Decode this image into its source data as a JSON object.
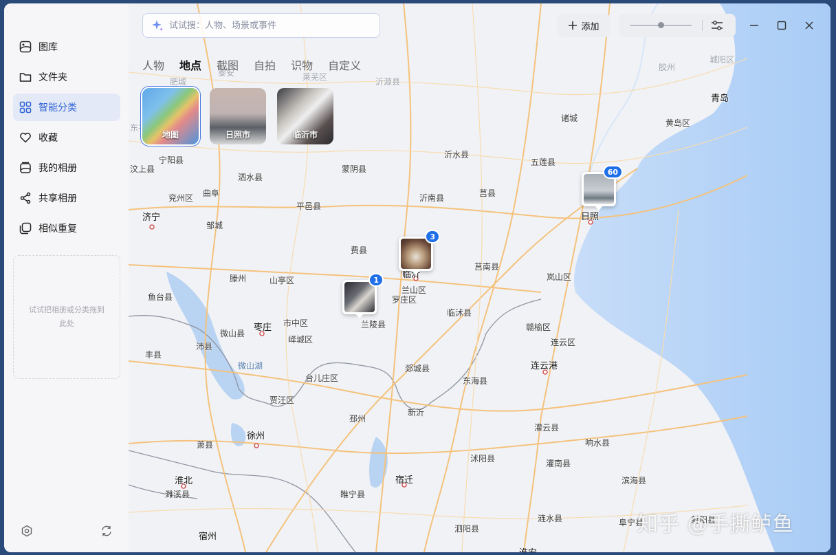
{
  "sidebar": {
    "items": [
      {
        "label": "图库",
        "icon": "gallery-icon"
      },
      {
        "label": "文件夹",
        "icon": "folder-icon"
      },
      {
        "label": "智能分类",
        "icon": "grid-icon",
        "active": true
      },
      {
        "label": "收藏",
        "icon": "heart-icon"
      },
      {
        "label": "我的相册",
        "icon": "album-icon"
      },
      {
        "label": "共享相册",
        "icon": "share-icon"
      },
      {
        "label": "相似重复",
        "icon": "duplicate-icon"
      }
    ],
    "drop_hint": "试试把相册或分类拖到此处",
    "bottom": {
      "settings_icon": "settings-icon",
      "sync_icon": "sync-icon"
    }
  },
  "search": {
    "placeholder": "试试搜：人物、场景或事件",
    "icon": "sparkle-icon"
  },
  "toolbar": {
    "add_label": "添加",
    "zoom_level": 0.5,
    "filter_icon": "sliders-icon"
  },
  "window_controls": {
    "minimize": "minimize-icon",
    "maximize": "maximize-icon",
    "close": "close-icon"
  },
  "tabs": [
    {
      "label": "人物"
    },
    {
      "label": "地点",
      "active": true
    },
    {
      "label": "截图"
    },
    {
      "label": "自拍"
    },
    {
      "label": "识物"
    },
    {
      "label": "自定义"
    }
  ],
  "places": [
    {
      "label": "地图",
      "active": true
    },
    {
      "label": "日照市"
    },
    {
      "label": "临沂市"
    }
  ],
  "map_markers": [
    {
      "city": "日照",
      "count": "60"
    },
    {
      "city": "临沂",
      "count": "3"
    },
    {
      "city": "兰陵县",
      "count": "1"
    }
  ],
  "map_labels": [
    "肥城",
    "泰安",
    "莱芜区",
    "沂源县",
    "胶州",
    "城阳区",
    "青岛",
    "黄岛区",
    "诸城",
    "宁阳县",
    "泗水县",
    "蒙阴县",
    "沂水县",
    "五莲县",
    "兖州区",
    "曲阜",
    "平邑县",
    "沂南县",
    "莒县",
    "济宁",
    "邹城",
    "费县",
    "临沂",
    "莒南县",
    "日照",
    "滕州",
    "山亭区",
    "兰山区",
    "罗庄区",
    "岚山区",
    "鱼台县",
    "枣庄",
    "市中区",
    "兰陵县",
    "临沭县",
    "赣榆区",
    "沛县",
    "微山县",
    "峄城区",
    "连云区",
    "丰县",
    "微山湖",
    "台儿庄区",
    "郯城县",
    "东海县",
    "连云港",
    "贾汪区",
    "邳州",
    "新沂",
    "灌云县",
    "徐州",
    "萧县",
    "响水县",
    "沭阳县",
    "灌南县",
    "宿迁",
    "淮北",
    "濉溪县",
    "睢宁县",
    "滨海县",
    "涟水县",
    "阜宁县",
    "泗阳县",
    "宿州",
    "淮安",
    "汶上县",
    "东平",
    "射阳县"
  ],
  "watermark": "知乎 @手撕鲈鱼"
}
